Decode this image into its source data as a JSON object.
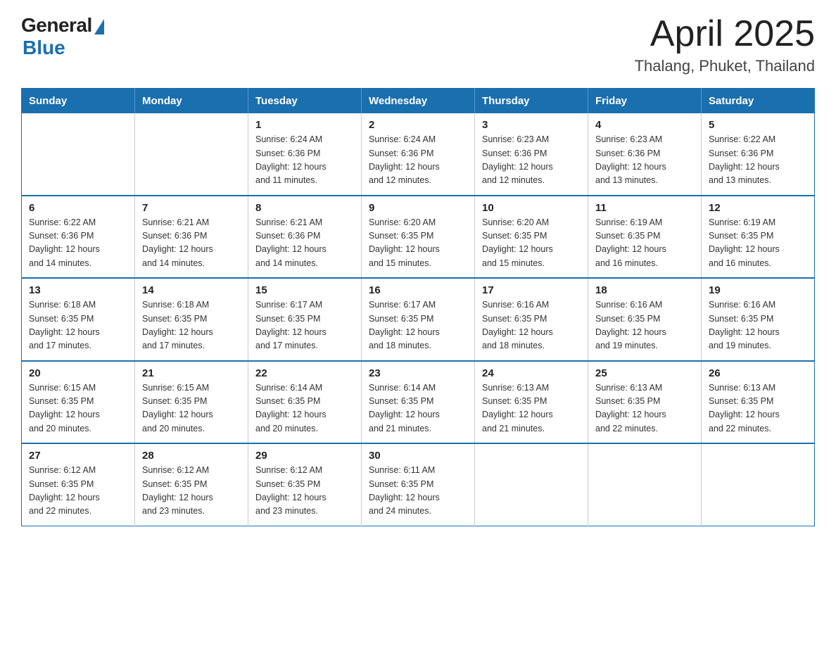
{
  "logo": {
    "general": "General",
    "blue": "Blue"
  },
  "title": {
    "month": "April 2025",
    "location": "Thalang, Phuket, Thailand"
  },
  "weekdays": [
    "Sunday",
    "Monday",
    "Tuesday",
    "Wednesday",
    "Thursday",
    "Friday",
    "Saturday"
  ],
  "weeks": [
    [
      {
        "day": "",
        "info": ""
      },
      {
        "day": "",
        "info": ""
      },
      {
        "day": "1",
        "info": "Sunrise: 6:24 AM\nSunset: 6:36 PM\nDaylight: 12 hours\nand 11 minutes."
      },
      {
        "day": "2",
        "info": "Sunrise: 6:24 AM\nSunset: 6:36 PM\nDaylight: 12 hours\nand 12 minutes."
      },
      {
        "day": "3",
        "info": "Sunrise: 6:23 AM\nSunset: 6:36 PM\nDaylight: 12 hours\nand 12 minutes."
      },
      {
        "day": "4",
        "info": "Sunrise: 6:23 AM\nSunset: 6:36 PM\nDaylight: 12 hours\nand 13 minutes."
      },
      {
        "day": "5",
        "info": "Sunrise: 6:22 AM\nSunset: 6:36 PM\nDaylight: 12 hours\nand 13 minutes."
      }
    ],
    [
      {
        "day": "6",
        "info": "Sunrise: 6:22 AM\nSunset: 6:36 PM\nDaylight: 12 hours\nand 14 minutes."
      },
      {
        "day": "7",
        "info": "Sunrise: 6:21 AM\nSunset: 6:36 PM\nDaylight: 12 hours\nand 14 minutes."
      },
      {
        "day": "8",
        "info": "Sunrise: 6:21 AM\nSunset: 6:36 PM\nDaylight: 12 hours\nand 14 minutes."
      },
      {
        "day": "9",
        "info": "Sunrise: 6:20 AM\nSunset: 6:35 PM\nDaylight: 12 hours\nand 15 minutes."
      },
      {
        "day": "10",
        "info": "Sunrise: 6:20 AM\nSunset: 6:35 PM\nDaylight: 12 hours\nand 15 minutes."
      },
      {
        "day": "11",
        "info": "Sunrise: 6:19 AM\nSunset: 6:35 PM\nDaylight: 12 hours\nand 16 minutes."
      },
      {
        "day": "12",
        "info": "Sunrise: 6:19 AM\nSunset: 6:35 PM\nDaylight: 12 hours\nand 16 minutes."
      }
    ],
    [
      {
        "day": "13",
        "info": "Sunrise: 6:18 AM\nSunset: 6:35 PM\nDaylight: 12 hours\nand 17 minutes."
      },
      {
        "day": "14",
        "info": "Sunrise: 6:18 AM\nSunset: 6:35 PM\nDaylight: 12 hours\nand 17 minutes."
      },
      {
        "day": "15",
        "info": "Sunrise: 6:17 AM\nSunset: 6:35 PM\nDaylight: 12 hours\nand 17 minutes."
      },
      {
        "day": "16",
        "info": "Sunrise: 6:17 AM\nSunset: 6:35 PM\nDaylight: 12 hours\nand 18 minutes."
      },
      {
        "day": "17",
        "info": "Sunrise: 6:16 AM\nSunset: 6:35 PM\nDaylight: 12 hours\nand 18 minutes."
      },
      {
        "day": "18",
        "info": "Sunrise: 6:16 AM\nSunset: 6:35 PM\nDaylight: 12 hours\nand 19 minutes."
      },
      {
        "day": "19",
        "info": "Sunrise: 6:16 AM\nSunset: 6:35 PM\nDaylight: 12 hours\nand 19 minutes."
      }
    ],
    [
      {
        "day": "20",
        "info": "Sunrise: 6:15 AM\nSunset: 6:35 PM\nDaylight: 12 hours\nand 20 minutes."
      },
      {
        "day": "21",
        "info": "Sunrise: 6:15 AM\nSunset: 6:35 PM\nDaylight: 12 hours\nand 20 minutes."
      },
      {
        "day": "22",
        "info": "Sunrise: 6:14 AM\nSunset: 6:35 PM\nDaylight: 12 hours\nand 20 minutes."
      },
      {
        "day": "23",
        "info": "Sunrise: 6:14 AM\nSunset: 6:35 PM\nDaylight: 12 hours\nand 21 minutes."
      },
      {
        "day": "24",
        "info": "Sunrise: 6:13 AM\nSunset: 6:35 PM\nDaylight: 12 hours\nand 21 minutes."
      },
      {
        "day": "25",
        "info": "Sunrise: 6:13 AM\nSunset: 6:35 PM\nDaylight: 12 hours\nand 22 minutes."
      },
      {
        "day": "26",
        "info": "Sunrise: 6:13 AM\nSunset: 6:35 PM\nDaylight: 12 hours\nand 22 minutes."
      }
    ],
    [
      {
        "day": "27",
        "info": "Sunrise: 6:12 AM\nSunset: 6:35 PM\nDaylight: 12 hours\nand 22 minutes."
      },
      {
        "day": "28",
        "info": "Sunrise: 6:12 AM\nSunset: 6:35 PM\nDaylight: 12 hours\nand 23 minutes."
      },
      {
        "day": "29",
        "info": "Sunrise: 6:12 AM\nSunset: 6:35 PM\nDaylight: 12 hours\nand 23 minutes."
      },
      {
        "day": "30",
        "info": "Sunrise: 6:11 AM\nSunset: 6:35 PM\nDaylight: 12 hours\nand 24 minutes."
      },
      {
        "day": "",
        "info": ""
      },
      {
        "day": "",
        "info": ""
      },
      {
        "day": "",
        "info": ""
      }
    ]
  ]
}
